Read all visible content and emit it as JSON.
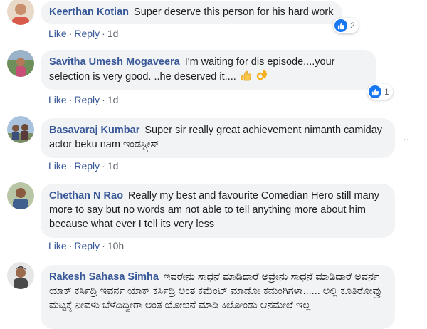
{
  "comments": [
    {
      "author": "Keerthan Kotian",
      "text": "Super deserve this person for his hard work",
      "like": "Like",
      "reply": "Reply",
      "time": "1d",
      "reaction_count": "2"
    },
    {
      "author": "Savitha Umesh Mogaveera",
      "text": "I'm waiting for dis episode....your selection is very good. ..he deserved it....",
      "emojis": [
        "thumbs-up-emoji",
        "ok-hand-emoji"
      ],
      "like": "Like",
      "reply": "Reply",
      "time": "1d",
      "reaction_count": "1"
    },
    {
      "author": "Basavaraj Kumbar",
      "text": "Super sir really great achievement nimanth camiday actor beku nam ಇಂಡಸ್ಟ್ರೀಸ್",
      "like": "Like",
      "reply": "Reply",
      "time": "1d",
      "more_icon": "…"
    },
    {
      "author": "Chethan N Rao",
      "text": "Really my best and favourite Comedian Hero still many more to say but no words am not able to tell anything more about him because what ever I tell its very less",
      "like": "Like",
      "reply": "Reply",
      "time": "10h"
    },
    {
      "author": "Rakesh Sahasa Simha",
      "text": "ಇವರೇನು ಸಾಧನೆ ಮಾಡಿದಾರೆ ಅವ್ರೇನು ಸಾಧನೆ ಮಾಡಿದಾರೆ ಅವರ್ನ ಯಾಕ್ ಕರ್ಸಿದ್ರಿ ಇವರ್ನ ಯಾಕ್ ಕರ್ಸಿದ್ರಿ ಅಂತ ಕಮೆಂಟ್ ಮಾಡೋ ಕಮಂಗಿಗಳಾ...... ಅಲ್ಲಿ ಕೂತಿರೋವ್ರು ಮಟ್ಟಕ್ಕೆ ನೀವಳು ಬೆಳೆದಿದ್ದೀರಾ ಅಂತ ಯೋಚನೆ ಮಾಡಿ ಕಿಲೋಂಡು ಆನಮೇಲೆ ಇಲ್ಲ"
    }
  ],
  "colors": {
    "author": "#385898",
    "bubble": "#f2f3f5",
    "meta": "#606770",
    "like_blue": "#1877f2"
  }
}
